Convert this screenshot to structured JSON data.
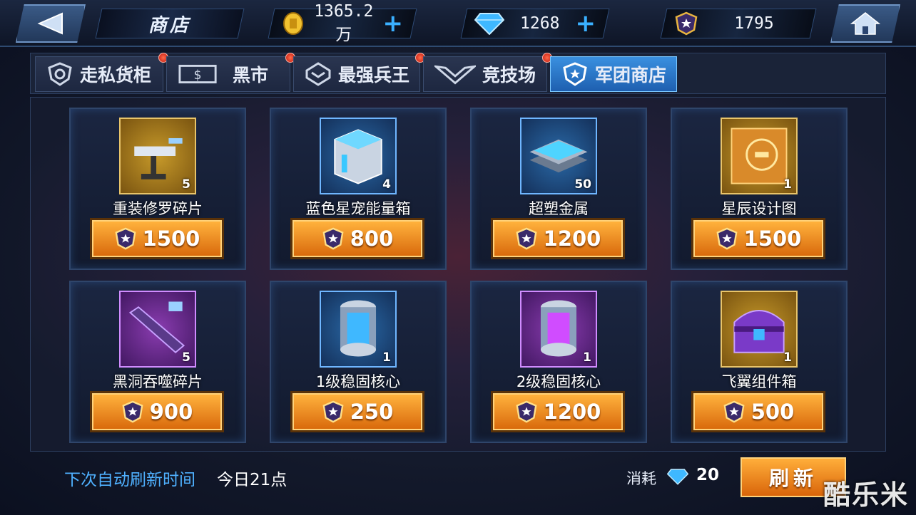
{
  "header": {
    "title": "商店",
    "coins": "1365.2万",
    "gems": "1268",
    "badges": "1795"
  },
  "tabs": [
    {
      "label": "走私货柜",
      "icon": "shield-gear-icon",
      "has_alert": true,
      "active": false
    },
    {
      "label": "黑市",
      "icon": "money-icon",
      "has_alert": true,
      "active": false
    },
    {
      "label": "最强兵王",
      "icon": "rank-chevron-icon",
      "has_alert": true,
      "active": false
    },
    {
      "label": "竞技场",
      "icon": "wings-icon",
      "has_alert": true,
      "active": false
    },
    {
      "label": "军团商店",
      "icon": "legion-star-icon",
      "has_alert": false,
      "active": true
    }
  ],
  "items": [
    {
      "name": "重装修罗碎片",
      "qty": "5",
      "price": "1500",
      "rarity": "gold",
      "icon": "mech-fragment-icon"
    },
    {
      "name": "蓝色星宠能量箱",
      "qty": "4",
      "price": "800",
      "rarity": "blue",
      "icon": "energy-box-icon"
    },
    {
      "name": "超塑金属",
      "qty": "50",
      "price": "1200",
      "rarity": "blue",
      "icon": "metal-plates-icon"
    },
    {
      "name": "星辰设计图",
      "qty": "1",
      "price": "1500",
      "rarity": "gold",
      "icon": "blueprint-icon"
    },
    {
      "name": "黑洞吞噬碎片",
      "qty": "5",
      "price": "900",
      "rarity": "purple",
      "icon": "cannon-fragment-icon"
    },
    {
      "name": "1级稳固核心",
      "qty": "1",
      "price": "250",
      "rarity": "blue",
      "icon": "core-capsule-icon"
    },
    {
      "name": "2级稳固核心",
      "qty": "1",
      "price": "1200",
      "rarity": "purple",
      "icon": "core-capsule-icon"
    },
    {
      "name": "飞翼组件箱",
      "qty": "1",
      "price": "500",
      "rarity": "gold",
      "icon": "wing-chest-icon"
    }
  ],
  "footer": {
    "next_refresh_label": "下次自动刷新时间",
    "next_refresh_value": "今日21点",
    "cost_label": "消耗",
    "cost_value": "20",
    "refresh_label": "刷新",
    "watermark": "酷乐米"
  },
  "colors": {
    "accent_blue": "#3ab0ff",
    "price_orange": "#d96a0c",
    "rarity_gold": "#c79a2a",
    "rarity_blue": "#2a6aa8",
    "rarity_purple": "#8a3cb0"
  }
}
